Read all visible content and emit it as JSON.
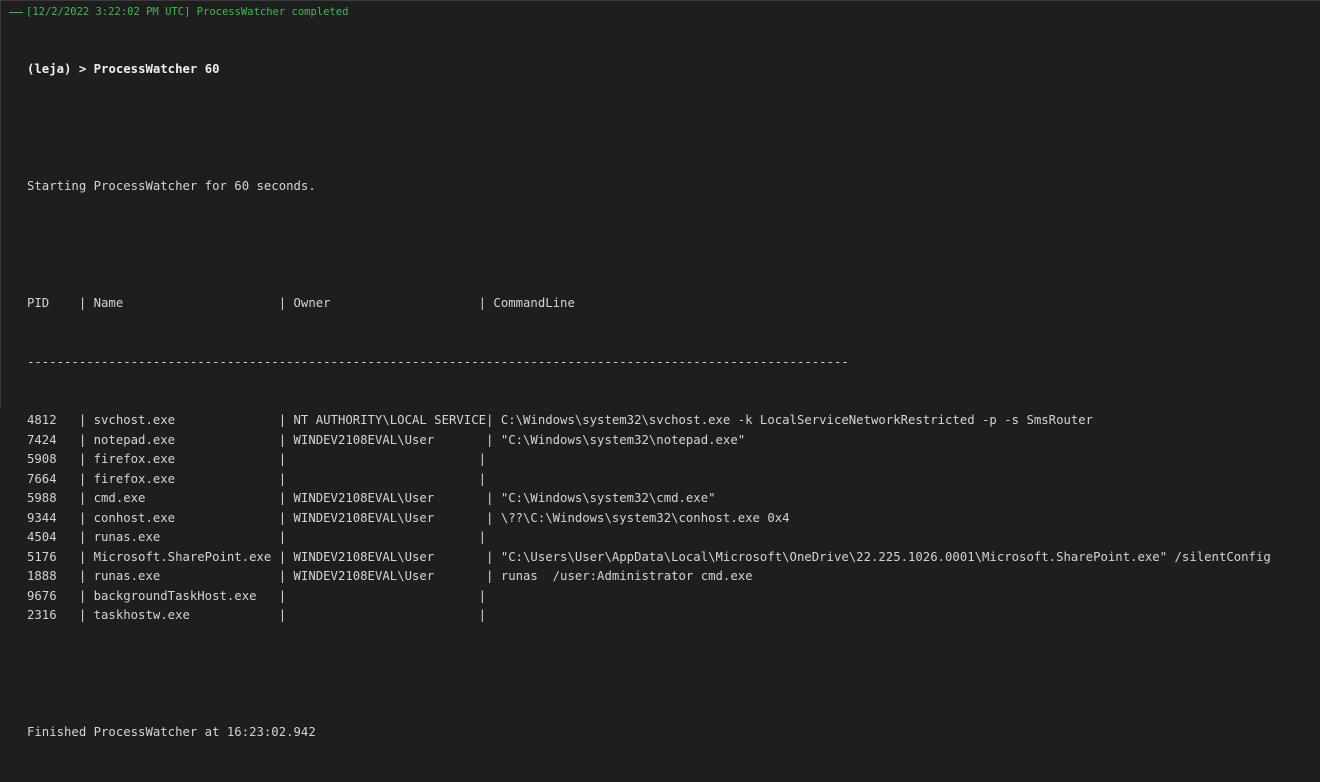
{
  "header": {
    "status": "[12/2/2022 3:22:02 PM UTC] ProcessWatcher completed"
  },
  "prompt": {
    "open_paren": "(",
    "user": "leja",
    "close_and_command": ") > ProcessWatcher 60"
  },
  "output": {
    "start_message": "Starting ProcessWatcher for 60 seconds.",
    "table": {
      "columns": [
        "PID",
        "Name",
        "Owner",
        "CommandLine"
      ],
      "header_line": "PID    | Name                     | Owner                    | CommandLine",
      "separator": "---------------------------------------------------------------------------------------------------------------",
      "rows": [
        {
          "pid": "4812",
          "name": "svchost.exe",
          "owner": "NT AUTHORITY\\LOCAL SERVICE",
          "cmd": "C:\\Windows\\system32\\svchost.exe -k LocalServiceNetworkRestricted -p -s SmsRouter",
          "line": "4812   | svchost.exe              | NT AUTHORITY\\LOCAL SERVICE| C:\\Windows\\system32\\svchost.exe -k LocalServiceNetworkRestricted -p -s SmsRouter"
        },
        {
          "pid": "7424",
          "name": "notepad.exe",
          "owner": "WINDEV2108EVAL\\User",
          "cmd": "\"C:\\Windows\\system32\\notepad.exe\"",
          "line": "7424   | notepad.exe              | WINDEV2108EVAL\\User       | \"C:\\Windows\\system32\\notepad.exe\""
        },
        {
          "pid": "5908",
          "name": "firefox.exe",
          "owner": "",
          "cmd": "",
          "line": "5908   | firefox.exe              |                          |"
        },
        {
          "pid": "7664",
          "name": "firefox.exe",
          "owner": "",
          "cmd": "",
          "line": "7664   | firefox.exe              |                          |"
        },
        {
          "pid": "5988",
          "name": "cmd.exe",
          "owner": "WINDEV2108EVAL\\User",
          "cmd": "\"C:\\Windows\\system32\\cmd.exe\"",
          "line": "5988   | cmd.exe                  | WINDEV2108EVAL\\User       | \"C:\\Windows\\system32\\cmd.exe\""
        },
        {
          "pid": "9344",
          "name": "conhost.exe",
          "owner": "WINDEV2108EVAL\\User",
          "cmd": "\\??\\C:\\Windows\\system32\\conhost.exe 0x4",
          "line": "9344   | conhost.exe              | WINDEV2108EVAL\\User       | \\??\\C:\\Windows\\system32\\conhost.exe 0x4"
        },
        {
          "pid": "4504",
          "name": "runas.exe",
          "owner": "",
          "cmd": "",
          "line": "4504   | runas.exe                |                          |"
        },
        {
          "pid": "5176",
          "name": "Microsoft.SharePoint.exe",
          "owner": "WINDEV2108EVAL\\User",
          "cmd": "\"C:\\Users\\User\\AppData\\Local\\Microsoft\\OneDrive\\22.225.1026.0001\\Microsoft.SharePoint.exe\" /silentConfig",
          "line": "5176   | Microsoft.SharePoint.exe | WINDEV2108EVAL\\User       | \"C:\\Users\\User\\AppData\\Local\\Microsoft\\OneDrive\\22.225.1026.0001\\Microsoft.SharePoint.exe\" /silentConfig"
        },
        {
          "pid": "1888",
          "name": "runas.exe",
          "owner": "WINDEV2108EVAL\\User",
          "cmd": "runas  /user:Administrator cmd.exe",
          "line": "1888   | runas.exe                | WINDEV2108EVAL\\User       | runas  /user:Administrator cmd.exe"
        },
        {
          "pid": "9676",
          "name": "backgroundTaskHost.exe",
          "owner": "",
          "cmd": "",
          "line": "9676   | backgroundTaskHost.exe   |                          |"
        },
        {
          "pid": "2316",
          "name": "taskhostw.exe",
          "owner": "",
          "cmd": "",
          "line": "2316   | taskhostw.exe            |                          |"
        }
      ]
    },
    "finish_message": "Finished ProcessWatcher at 16:23:02.942"
  },
  "colors": {
    "background": "#1e1e1e",
    "text": "#d4d4d4",
    "header_green": "#3fb950"
  }
}
